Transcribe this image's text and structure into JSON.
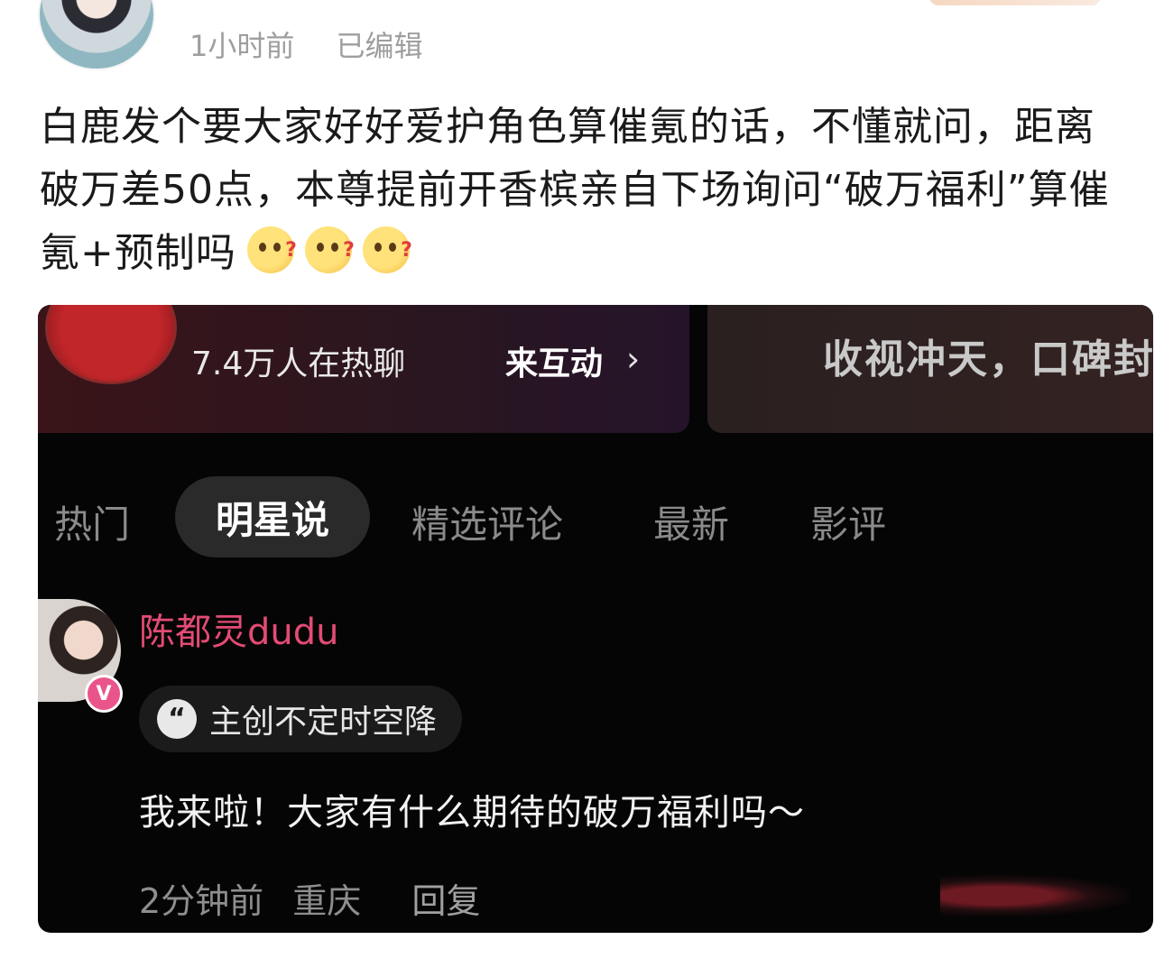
{
  "post": {
    "author_name": "",
    "time": "1小时前",
    "edited": "已编辑",
    "text": "白鹿发个要大家好好爱护角色算催氪的话，不懂就问，距离破万差50点，本尊提前开香槟亲自下场询问“破万福利”算催氪+预制吗",
    "emojis": [
      "thinking-emoji",
      "thinking-emoji",
      "thinking-emoji"
    ]
  },
  "screenshot": {
    "top_card": {
      "heat_text": "7.4万人在热聊",
      "interact_label": "来互动",
      "right_text": "收视冲天，口碑封"
    },
    "tabs": [
      {
        "label": "热门"
      },
      {
        "label": "明星说"
      },
      {
        "label": "精选评论"
      },
      {
        "label": "最新"
      },
      {
        "label": "影评"
      }
    ],
    "comment": {
      "name": "陈都灵dudu",
      "tag": "主创不定时空降",
      "text": "我来啦！大家有什么期待的破万福利吗～",
      "time": "2分钟前",
      "location": "重庆",
      "reply": "回复"
    }
  },
  "colors": {
    "commenter_name": "#e34b74",
    "post_meta": "#9e9e9e",
    "dark_bg": "#050505"
  }
}
